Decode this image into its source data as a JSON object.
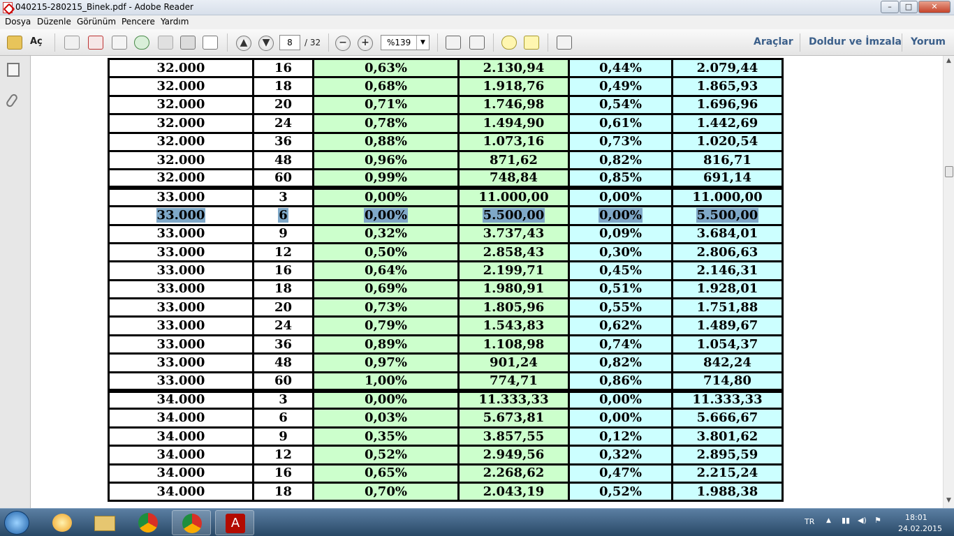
{
  "window": {
    "title": "040215-280215_Binek.pdf - Adobe Reader",
    "min": "–",
    "max": "□",
    "close": "✕"
  },
  "menu": [
    "Dosya",
    "Düzenle",
    "Görünüm",
    "Pencere",
    "Yardım"
  ],
  "toolbar": {
    "open_label": "Aç",
    "page_current": "8",
    "page_total": "/ 32",
    "zoom_value": "%139",
    "tools_label": "Araçlar",
    "fill_sign_label": "Doldur ve İmzala",
    "comment_label": "Yorum"
  },
  "table": {
    "rows": [
      {
        "cells": [
          "32.000",
          "16",
          "0,63%",
          "2.130,94",
          "0,44%",
          "2.079,44"
        ]
      },
      {
        "cells": [
          "32.000",
          "18",
          "0,68%",
          "1.918,76",
          "0,49%",
          "1.865,93"
        ]
      },
      {
        "cells": [
          "32.000",
          "20",
          "0,71%",
          "1.746,98",
          "0,54%",
          "1.696,96"
        ]
      },
      {
        "cells": [
          "32.000",
          "24",
          "0,78%",
          "1.494,90",
          "0,61%",
          "1.442,69"
        ]
      },
      {
        "cells": [
          "32.000",
          "36",
          "0,88%",
          "1.073,16",
          "0,73%",
          "1.020,54"
        ]
      },
      {
        "cells": [
          "32.000",
          "48",
          "0,96%",
          "871,62",
          "0,82%",
          "816,71"
        ]
      },
      {
        "cells": [
          "32.000",
          "60",
          "0,99%",
          "748,84",
          "0,85%",
          "691,14"
        ]
      },
      {
        "cells": [
          "33.000",
          "3",
          "0,00%",
          "11.000,00",
          "0,00%",
          "11.000,00"
        ],
        "group_start": true
      },
      {
        "cells": [
          "33.000",
          "6",
          "0,00%",
          "5.500,00",
          "0,00%",
          "5.500,00"
        ],
        "highlighted": true
      },
      {
        "cells": [
          "33.000",
          "9",
          "0,32%",
          "3.737,43",
          "0,09%",
          "3.684,01"
        ]
      },
      {
        "cells": [
          "33.000",
          "12",
          "0,50%",
          "2.858,43",
          "0,30%",
          "2.806,63"
        ]
      },
      {
        "cells": [
          "33.000",
          "16",
          "0,64%",
          "2.199,71",
          "0,45%",
          "2.146,31"
        ]
      },
      {
        "cells": [
          "33.000",
          "18",
          "0,69%",
          "1.980,91",
          "0,51%",
          "1.928,01"
        ]
      },
      {
        "cells": [
          "33.000",
          "20",
          "0,73%",
          "1.805,96",
          "0,55%",
          "1.751,88"
        ]
      },
      {
        "cells": [
          "33.000",
          "24",
          "0,79%",
          "1.543,83",
          "0,62%",
          "1.489,67"
        ]
      },
      {
        "cells": [
          "33.000",
          "36",
          "0,89%",
          "1.108,98",
          "0,74%",
          "1.054,37"
        ]
      },
      {
        "cells": [
          "33.000",
          "48",
          "0,97%",
          "901,24",
          "0,82%",
          "842,24"
        ]
      },
      {
        "cells": [
          "33.000",
          "60",
          "1,00%",
          "774,71",
          "0,86%",
          "714,80"
        ]
      },
      {
        "cells": [
          "34.000",
          "3",
          "0,00%",
          "11.333,33",
          "0,00%",
          "11.333,33"
        ],
        "group_start": true
      },
      {
        "cells": [
          "34.000",
          "6",
          "0,03%",
          "5.673,81",
          "0,00%",
          "5.666,67"
        ]
      },
      {
        "cells": [
          "34.000",
          "9",
          "0,35%",
          "3.857,55",
          "0,12%",
          "3.801,62"
        ]
      },
      {
        "cells": [
          "34.000",
          "12",
          "0,52%",
          "2.949,56",
          "0,32%",
          "2.895,59"
        ]
      },
      {
        "cells": [
          "34.000",
          "16",
          "0,65%",
          "2.268,62",
          "0,47%",
          "2.215,24"
        ]
      },
      {
        "cells": [
          "34.000",
          "18",
          "0,70%",
          "2.043,19",
          "0,52%",
          "1.988,38"
        ]
      }
    ]
  },
  "taskbar": {
    "language": "TR",
    "time": "18:01",
    "date": "24.02.2015"
  },
  "colors": {
    "green_cell": "#ccffcc",
    "cyan_cell": "#ccffff",
    "selection": "#7fa8c8",
    "link_blue": "#3b5f8a"
  }
}
